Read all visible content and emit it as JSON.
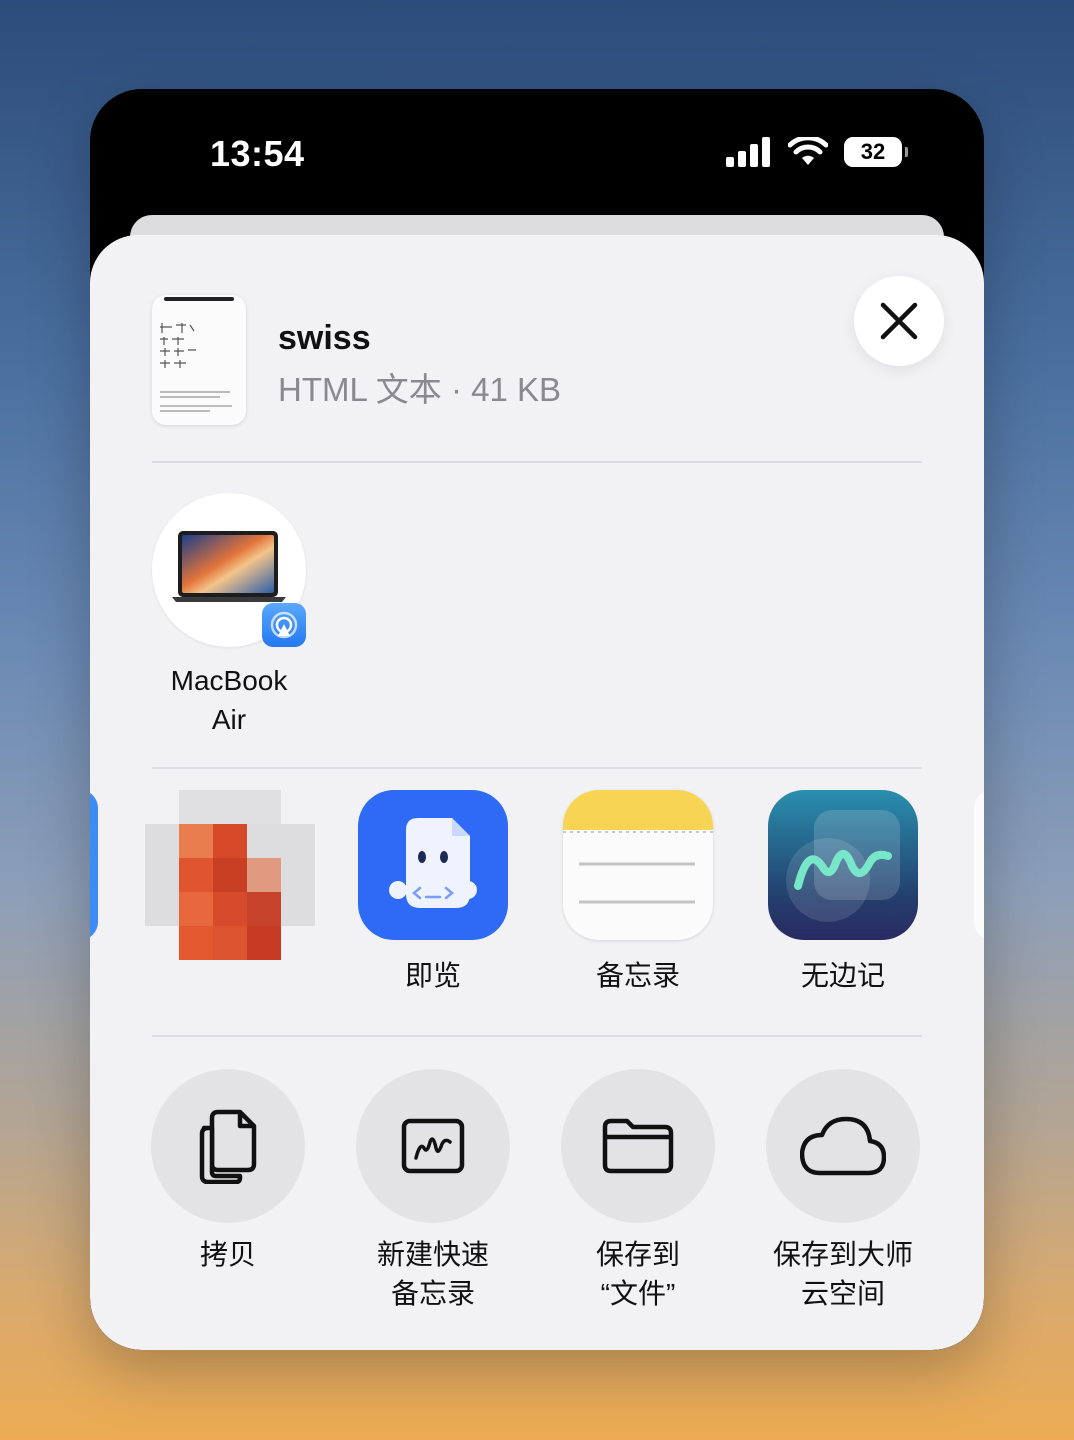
{
  "status": {
    "time": "13:54",
    "battery": "32"
  },
  "document": {
    "title": "swiss",
    "subtitle": "HTML 文本 · 41 KB"
  },
  "airdrop": {
    "device_label_line1": "MacBook",
    "device_label_line2": "Air"
  },
  "apps": [
    {
      "label": ""
    },
    {
      "label": "即览"
    },
    {
      "label": "备忘录"
    },
    {
      "label": "无边记"
    }
  ],
  "actions": [
    {
      "line1": "拷贝",
      "line2": "",
      "icon": "copy-icon"
    },
    {
      "line1": "新建快速",
      "line2": "备忘录",
      "icon": "quick-note-icon"
    },
    {
      "line1": "保存到",
      "line2": "“文件”",
      "icon": "folder-icon"
    },
    {
      "line1": "保存到大师",
      "line2": "云空间",
      "icon": "cloud-icon"
    }
  ],
  "colors": {
    "airdrop_blue": "#2f8bff",
    "quicklook_blue": "#2e6af5",
    "notes_yellow": "#f7d454",
    "freeform_teal": "#2a7f9e"
  }
}
